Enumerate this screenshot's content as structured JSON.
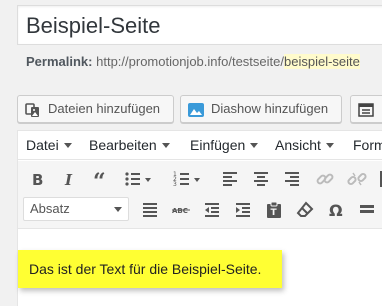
{
  "title": {
    "value": "Beispiel-Seite"
  },
  "permalink": {
    "label": "Permalink:",
    "base_url": "http://promotionjob.info/testseite/",
    "slug": "beispiel-seite"
  },
  "media_buttons": {
    "add_media": {
      "label": "Dateien hinzufügen",
      "icon": "add-media-icon"
    },
    "slideshow": {
      "label": "Diashow hinzufügen",
      "icon": "slideshow-icon"
    },
    "extra": {
      "icon": "form-icon"
    }
  },
  "menubar": [
    {
      "label": "Datei"
    },
    {
      "label": "Bearbeiten"
    },
    {
      "label": "Einfügen"
    },
    {
      "label": "Ansicht"
    },
    {
      "label": "Form"
    }
  ],
  "toolbar_row1": [
    "bold-icon",
    "italic-icon",
    "blockquote-icon",
    "bullet-list-icon",
    "numbered-list-icon",
    "align-left-icon",
    "align-center-icon",
    "align-right-icon",
    "link-icon",
    "unlink-icon"
  ],
  "format_select": {
    "value": "Absatz"
  },
  "toolbar_row2": [
    "justify-icon",
    "strikethrough-icon",
    "outdent-icon",
    "indent-icon",
    "paste-text-icon",
    "clear-formatting-icon",
    "special-char-icon",
    "horizontal-line-icon"
  ],
  "content": {
    "text": "Das ist der Text für die Beispiel-Seite."
  },
  "colors": {
    "highlight": "#ffff33",
    "slug_highlight": "#fffbcc",
    "slideshow_icon": "#3a9ad9"
  }
}
